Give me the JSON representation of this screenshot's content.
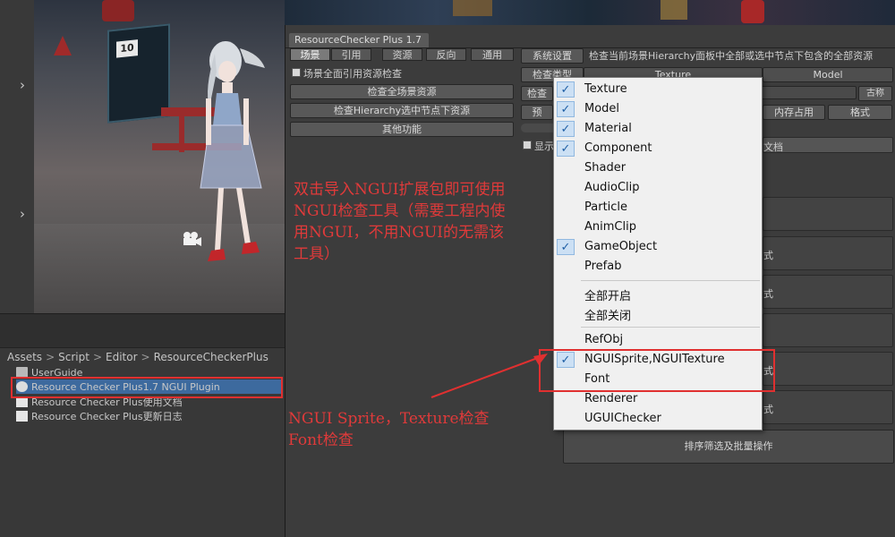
{
  "scene": {
    "sign_text": "10"
  },
  "project": {
    "breadcrumb": [
      "Assets",
      "Script",
      "Editor",
      "ResourceCheckerPlus"
    ],
    "breadcrumb_more": ">",
    "files": [
      {
        "name": "UserGuide",
        "icon": "folder-icon"
      },
      {
        "name": "Resource Checker Plus1.7 NGUI Plugin",
        "icon": "unity-package-icon"
      },
      {
        "name": "Resource Checker Plus使用文档",
        "icon": "document-icon"
      },
      {
        "name": "Resource Checker Plus更新日志",
        "icon": "document-icon"
      }
    ]
  },
  "window": {
    "title": "ResourceChecker Plus 1.7",
    "tabs": [
      "场景",
      "引用",
      "资源",
      "反向",
      "通用"
    ],
    "scene_ref_check_label": "场景全面引用资源检查",
    "buttons": {
      "check_all_scene": "检查全场景资源",
      "check_hierarchy": "检查Hierarchy选中节点下资源",
      "other_features": "其他功能",
      "system_settings": "系统设置",
      "check_type": "检查类型",
      "check_short": "检查",
      "preset_short": "预",
      "memory_usage": "内存占用",
      "format": "格式",
      "right_small": "古称",
      "sort_filter": "排序筛选及批量操作",
      "partial_style": "式"
    },
    "description": "检查当前场景Hierarchy面板中全部或选中节点下包含的全部资源",
    "type_headers": [
      "Texture",
      "Model"
    ],
    "show_label": "显示",
    "doc_label": "文档"
  },
  "menu": {
    "items": [
      {
        "label": "Texture",
        "checked": true
      },
      {
        "label": "Model",
        "checked": true
      },
      {
        "label": "Material",
        "checked": true
      },
      {
        "label": "Component",
        "checked": true
      },
      {
        "label": "Shader",
        "checked": false
      },
      {
        "label": "AudioClip",
        "checked": false
      },
      {
        "label": "Particle",
        "checked": false
      },
      {
        "label": "AnimClip",
        "checked": false
      },
      {
        "label": "GameObject",
        "checked": true
      },
      {
        "label": "Prefab",
        "checked": false
      }
    ],
    "toggle_items": [
      {
        "label": "全部开启"
      },
      {
        "label": "全部关闭"
      }
    ],
    "extra_items": [
      {
        "label": "RefObj",
        "checked": false
      },
      {
        "label": "NGUISprite,NGUITexture",
        "checked": true
      },
      {
        "label": "Font",
        "checked": false
      },
      {
        "label": "Renderer",
        "checked": false
      },
      {
        "label": "UGUIChecker",
        "checked": false
      }
    ],
    "check_mark": "✓"
  },
  "annotations": {
    "ngui_tool_note": [
      "双击导入NGUI扩展包即可使用",
      "NGUI检查工具（需要工程内使",
      "用NGUI，不用NGUI的无需该",
      "工具）"
    ],
    "ngui_check_note": [
      "NGUI Sprite，Texture检查",
      "Font检查"
    ]
  },
  "colors": {
    "accent_red": "#e03030",
    "selection_blue": "#3d6a9e",
    "menu_check_bg": "#cce0f4"
  }
}
